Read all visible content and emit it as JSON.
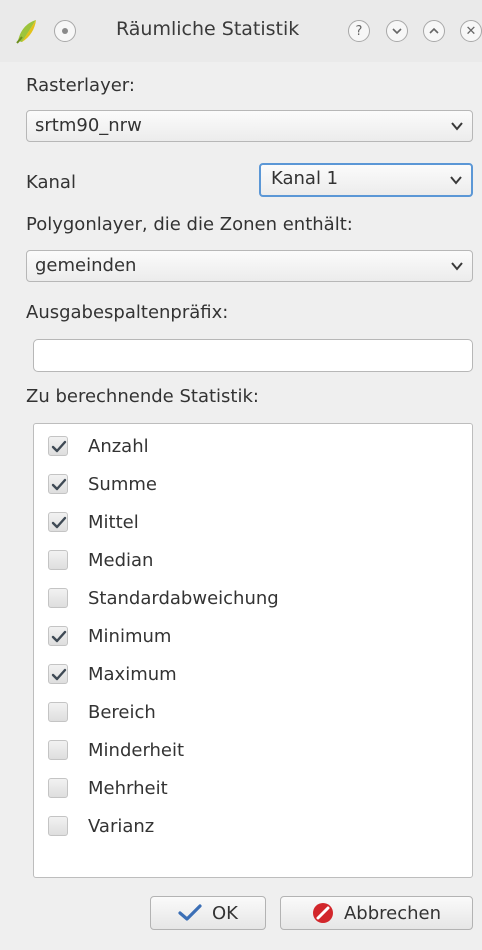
{
  "window": {
    "title": "Räumliche Statistik",
    "help_icon": "help-icon",
    "close_glyph": "✕"
  },
  "raster_layer": {
    "label": "Rasterlayer:",
    "value": "srtm90_nrw"
  },
  "band": {
    "label": "Kanal",
    "value": "Kanal 1"
  },
  "polygon_layer": {
    "label": "Polygonlayer, die die Zonen enthält:",
    "value": "gemeinden"
  },
  "prefix": {
    "label": "Ausgabespaltenpräfix:",
    "value": "",
    "placeholder": ""
  },
  "statistics": {
    "label": "Zu berechnende Statistik:",
    "items": [
      {
        "label": "Anzahl",
        "checked": true
      },
      {
        "label": "Summe",
        "checked": true
      },
      {
        "label": "Mittel",
        "checked": true
      },
      {
        "label": "Median",
        "checked": false
      },
      {
        "label": "Standardabweichung",
        "checked": false
      },
      {
        "label": "Minimum",
        "checked": true
      },
      {
        "label": "Maximum",
        "checked": true
      },
      {
        "label": "Bereich",
        "checked": false
      },
      {
        "label": "Minderheit",
        "checked": false
      },
      {
        "label": "Mehrheit",
        "checked": false
      },
      {
        "label": "Varianz",
        "checked": false
      }
    ]
  },
  "buttons": {
    "ok_label": "OK",
    "cancel_label": "Abbrechen"
  },
  "colors": {
    "accent": "#5b97d6",
    "check": "#3f4a55",
    "cancel_red": "#d2262b",
    "ok_blue": "#3b6fb6"
  }
}
